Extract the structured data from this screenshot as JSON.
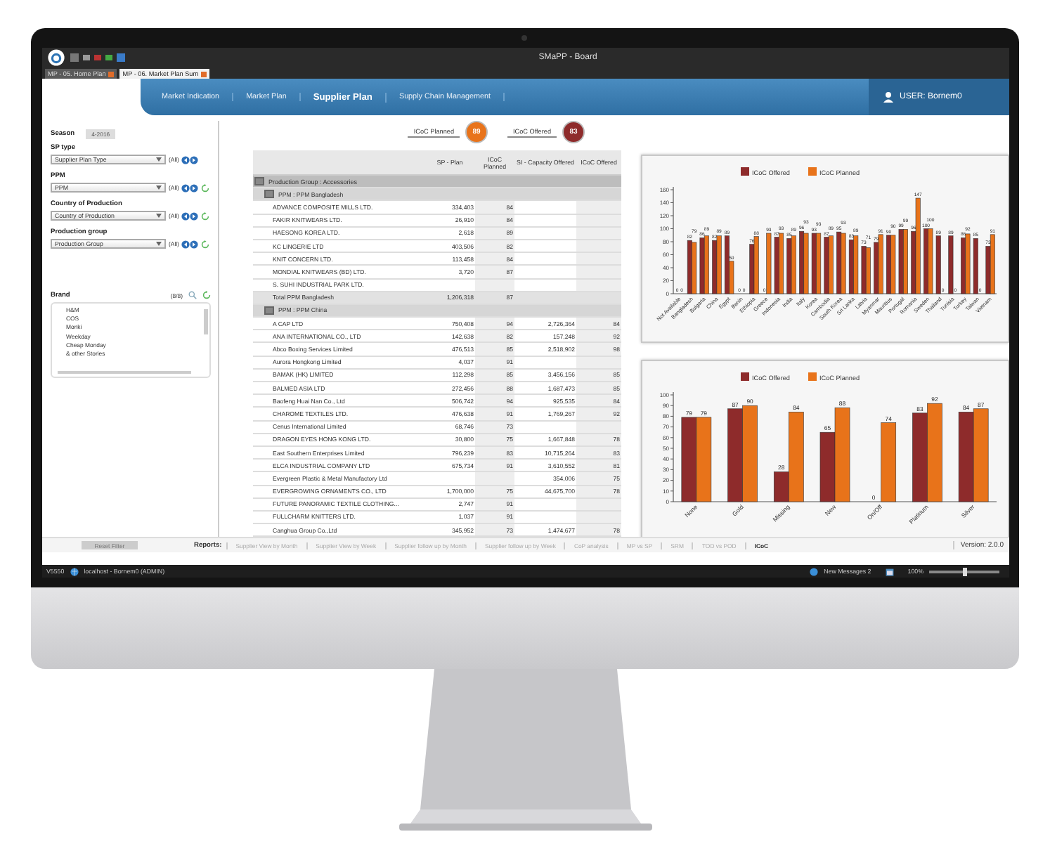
{
  "window": {
    "title": "SMaPP - Board"
  },
  "tabs": [
    {
      "label": "MP - 05. Home Plan",
      "selected": false
    },
    {
      "label": "MP - 06. Market Plan Sum",
      "selected": true
    }
  ],
  "nav": {
    "items": [
      {
        "label": "Market Indication",
        "selected": false
      },
      {
        "label": "Market Plan",
        "selected": false
      },
      {
        "label": "Supplier Plan",
        "selected": true
      },
      {
        "label": "Supply Chain Management",
        "selected": false
      }
    ],
    "user": "USER: Bornem0"
  },
  "filters": {
    "season": {
      "label": "Season",
      "value": "4-2016"
    },
    "fields": [
      {
        "label": "SP type",
        "value": "Supplier Plan Type",
        "all": "(All)",
        "refresh": false
      },
      {
        "label": "PPM",
        "value": "PPM",
        "all": "(All)",
        "refresh": true
      },
      {
        "label": "Country of Production",
        "value": "Country of Production",
        "all": "(All)",
        "refresh": true
      },
      {
        "label": "Production group",
        "value": "Production Group",
        "all": "(All)",
        "refresh": true
      }
    ],
    "brand": {
      "label": "Brand",
      "count": "(8/8)",
      "items": [
        "H&M",
        "COS",
        "Monki",
        "Weekday",
        "Cheap Monday",
        "& other Stories"
      ]
    }
  },
  "kpis": [
    {
      "label": "ICoC Planned",
      "value": "89",
      "color": "#e8731a"
    },
    {
      "label": "ICoC Offered",
      "value": "83",
      "color": "#8e2b2b"
    }
  ],
  "table": {
    "columns": [
      "SP - Plan",
      "ICoC Planned",
      "SI - Capacity Offered",
      "ICoC Offered"
    ],
    "rows": [
      {
        "kind": "group",
        "label": "Production Group : Accessories"
      },
      {
        "kind": "subgroup",
        "label": "PPM : PPM Bangladesh"
      },
      {
        "kind": "row",
        "cells": [
          "ADVANCE COMPOSITE MILLS LTD.",
          "334,403",
          "84",
          null,
          null
        ]
      },
      {
        "kind": "row",
        "cells": [
          "FAKIR KNITWEARS LTD.",
          "26,910",
          "84",
          null,
          null
        ]
      },
      {
        "kind": "row",
        "cells": [
          "HAESONG KOREA LTD.",
          "2,618",
          "89",
          null,
          null
        ]
      },
      {
        "kind": "row",
        "cells": [
          "KC LINGERIE LTD",
          "403,506",
          "82",
          null,
          null
        ]
      },
      {
        "kind": "row",
        "cells": [
          "KNIT CONCERN LTD.",
          "113,458",
          "84",
          null,
          null
        ]
      },
      {
        "kind": "row",
        "cells": [
          "MONDIAL KNITWEARS (BD) LTD.",
          "3,720",
          "87",
          null,
          null
        ]
      },
      {
        "kind": "row",
        "cells": [
          "S. SUHI INDUSTRIAL PARK LTD.",
          null,
          null,
          null,
          null
        ]
      },
      {
        "kind": "total",
        "cells": [
          "Total PPM Bangladesh",
          "1,206,318",
          "87",
          null,
          null
        ]
      },
      {
        "kind": "subgroup",
        "label": "PPM : PPM China"
      },
      {
        "kind": "row",
        "cells": [
          "A CAP LTD",
          "750,408",
          "94",
          "2,726,364",
          "84"
        ]
      },
      {
        "kind": "row",
        "cells": [
          "ANA INTERNATIONAL CO., LTD",
          "142,638",
          "82",
          "157,248",
          "92"
        ]
      },
      {
        "kind": "row",
        "cells": [
          "Abco Boxing Services Limited",
          "476,513",
          "85",
          "2,518,902",
          "98"
        ]
      },
      {
        "kind": "row",
        "cells": [
          "Aurora Hongkong Limited",
          "4,037",
          "91",
          null,
          null
        ]
      },
      {
        "kind": "row",
        "cells": [
          "BAMAK (HK) LIMITED",
          "112,298",
          "85",
          "3,456,156",
          "85"
        ]
      },
      {
        "kind": "row",
        "cells": [
          "BALMED ASIA LTD",
          "272,456",
          "88",
          "1,687,473",
          "85"
        ]
      },
      {
        "kind": "row",
        "cells": [
          "Baofeng Huai Nan Co., Ltd",
          "506,742",
          "94",
          "925,535",
          "84"
        ]
      },
      {
        "kind": "row",
        "cells": [
          "CHAROME TEXTILES LTD.",
          "476,638",
          "91",
          "1,769,267",
          "92"
        ]
      },
      {
        "kind": "row",
        "cells": [
          "Cenus International Limited",
          "68,746",
          "73",
          null,
          null
        ]
      },
      {
        "kind": "row",
        "cells": [
          "DRAGON EYES HONG KONG LTD.",
          "30,800",
          "75",
          "1,667,848",
          "78"
        ]
      },
      {
        "kind": "row",
        "cells": [
          "East Southern Enterprises Limited",
          "796,239",
          "83",
          "10,715,264",
          "83"
        ]
      },
      {
        "kind": "row",
        "cells": [
          "ELCA INDUSTRIAL COMPANY LTD",
          "675,734",
          "91",
          "3,610,552",
          "81"
        ]
      },
      {
        "kind": "row",
        "cells": [
          "Evergreen Plastic & Metal Manufactory Ltd",
          null,
          null,
          "354,006",
          "75"
        ]
      },
      {
        "kind": "row",
        "cells": [
          "EVERGROWING ORNAMENTS CO., LTD",
          "1,700,000",
          "75",
          "44,675,700",
          "78"
        ]
      },
      {
        "kind": "row",
        "cells": [
          "FUTURE PANORAMIC TEXTILE CLOTHING...",
          "2,747",
          "91",
          null,
          null
        ]
      },
      {
        "kind": "row",
        "cells": [
          "FULLCHARM KNITTERS LTD.",
          "1,037",
          "91",
          null,
          null
        ]
      },
      {
        "kind": "row",
        "cells": [
          "Canghua Group Co.,Ltd",
          "345,952",
          "73",
          "1,474,677",
          "78"
        ]
      }
    ]
  },
  "charts": [
    {
      "chart_data": {
        "type": "bar",
        "categories": [
          "Not Available",
          "Bangladesh",
          "Bulgaria",
          "China",
          "Egypt",
          "Benin",
          "Ethiopia",
          "Greece",
          "Indonesia",
          "India",
          "Italy",
          "Korea",
          "Cambodia",
          "South Korea",
          "Sri Lanka",
          "Latvia",
          "Myanmar",
          "Mauritius",
          "Portugal",
          "Romania",
          "Sweden",
          "Thailand",
          "Tunisia",
          "Turkey",
          "Taiwan",
          "Vietnam"
        ],
        "series": [
          {
            "name": "ICoC Offered",
            "color": "#8e2b2b",
            "values": [
              0,
              82,
              86,
              82,
              89,
              0,
              76,
              0,
              87,
              85,
              96,
              93,
              87,
              95,
              83,
              73,
              79,
              90,
              99,
              96,
              100,
              89,
              89,
              86,
              85,
              73
            ]
          },
          {
            "name": "ICoC Planned",
            "color": "#e8731a",
            "values": [
              0,
              79,
              89,
              89,
              50,
              0,
              88,
              93,
              93,
              89,
              93,
              93,
              89,
              93,
              89,
              71,
              91,
              90,
              99,
              147,
              100,
              0,
              0,
              92,
              0,
              91
            ]
          }
        ],
        "ylim": [
          0,
          160
        ],
        "yticks": [
          0,
          20,
          40,
          60,
          80,
          100,
          120,
          140,
          160
        ],
        "data_labels": true,
        "legend": "top"
      }
    },
    {
      "chart_data": {
        "type": "bar",
        "categories": [
          "None",
          "Gold",
          "Missing",
          "New",
          "On/Off",
          "Platinum",
          "Silver"
        ],
        "series": [
          {
            "name": "ICoC Offered",
            "color": "#8e2b2b",
            "values": [
              79,
              87,
              28,
              65,
              0,
              83,
              84
            ]
          },
          {
            "name": "ICoC Planned",
            "color": "#e8731a",
            "values": [
              79,
              90,
              84,
              88,
              74,
              92,
              87
            ]
          }
        ],
        "ylim": [
          0,
          100
        ],
        "yticks": [
          0,
          10,
          20,
          30,
          40,
          50,
          60,
          70,
          80,
          90,
          100
        ],
        "data_labels": true,
        "legend": "top"
      }
    }
  ],
  "reports": {
    "reset": "Reset Filter",
    "label": "Reports:",
    "items": [
      {
        "label": "Supplier View by Month",
        "selected": false
      },
      {
        "label": "Supplier View by Week",
        "selected": false
      },
      {
        "label": "Supplier follow up by Month",
        "selected": false
      },
      {
        "label": "Supplier follow up by Week",
        "selected": false
      },
      {
        "label": "CoP analysis",
        "selected": false
      },
      {
        "label": "MP vs SP",
        "selected": false
      },
      {
        "label": "SRM",
        "selected": false
      },
      {
        "label": "TOD vs POD",
        "selected": false
      },
      {
        "label": "ICoC",
        "selected": true
      }
    ],
    "version": "Version: 2.0.0"
  },
  "status_bar": {
    "build": "V5550",
    "server": "localhost - Bornem0 (ADMIN)",
    "messages": "New Messages 2",
    "zoom": "100%",
    "zoom_slider": {
      "level": 0.5
    }
  }
}
